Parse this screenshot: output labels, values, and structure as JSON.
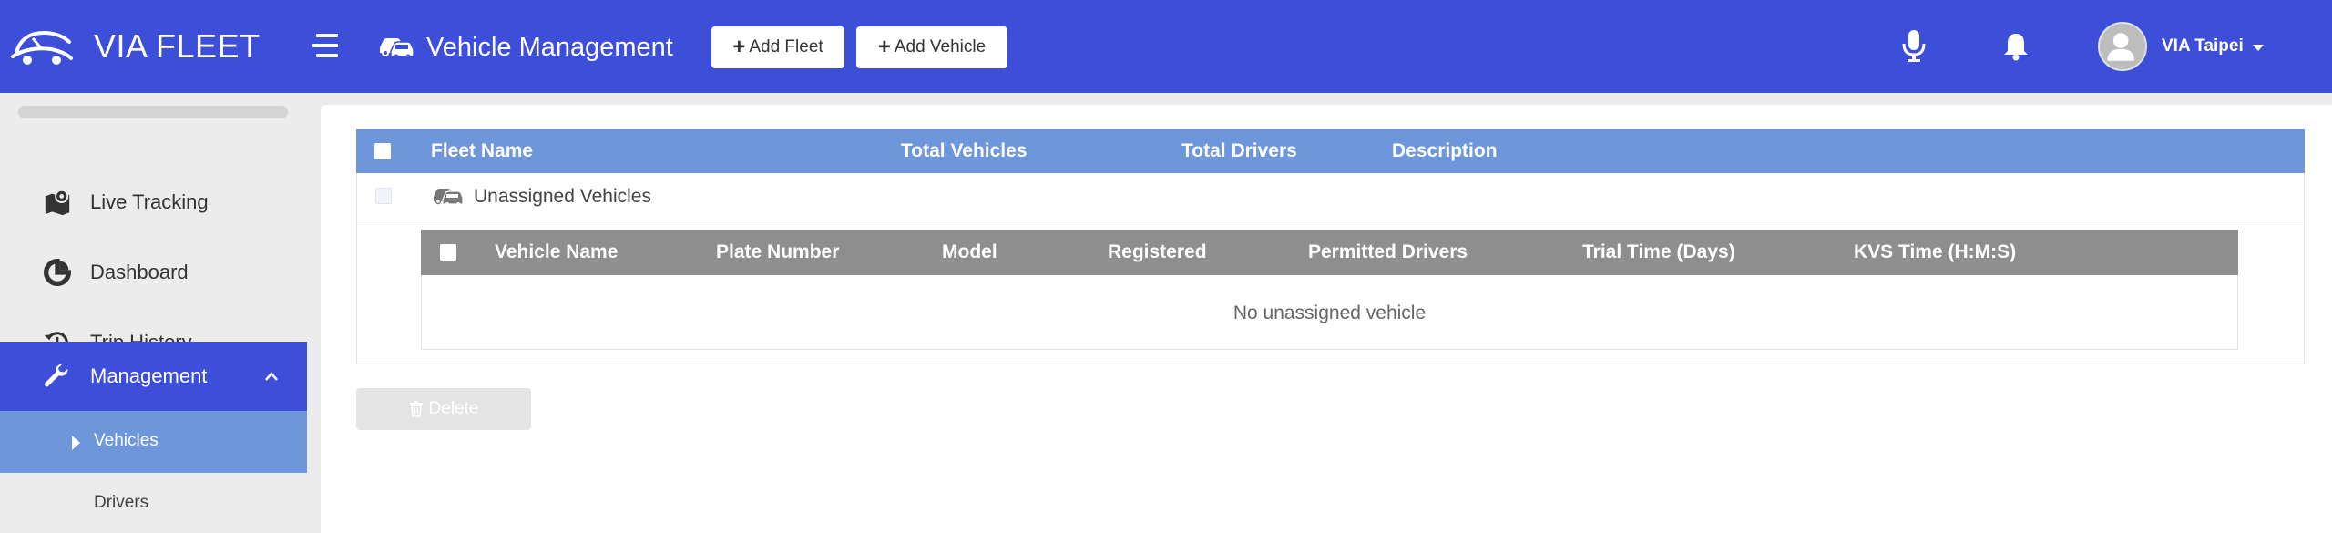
{
  "header": {
    "brand": "VIA FLEET",
    "page_title": "Vehicle Management",
    "add_fleet_label": "Add Fleet",
    "add_vehicle_label": "Add Vehicle",
    "user_name": "VIA Taipei",
    "icons": {
      "logo": "car-logo-icon",
      "menu": "hamburger-menu-icon",
      "page": "vehicles-icon",
      "mic": "microphone-icon",
      "bell": "bell-icon",
      "avatar": "user-avatar-icon"
    },
    "colors": {
      "bar": "#3d4fd9"
    }
  },
  "sidebar": {
    "items": [
      {
        "label": "Live Tracking",
        "icon": "map-pin-icon"
      },
      {
        "label": "Dashboard",
        "icon": "pie-chart-icon"
      },
      {
        "label": "Trip History",
        "icon": "history-icon"
      },
      {
        "label": "Management",
        "icon": "wrench-icon",
        "active": true,
        "expanded": true
      }
    ],
    "sub_items": [
      {
        "label": "Vehicles",
        "active": true
      },
      {
        "label": "Drivers"
      }
    ]
  },
  "fleet_table": {
    "columns": [
      "Fleet Name",
      "Total Vehicles",
      "Total Drivers",
      "Description"
    ],
    "rows": [
      {
        "name": "Unassigned Vehicles",
        "icon": "vehicles-icon"
      }
    ]
  },
  "vehicle_table": {
    "columns": [
      "Vehicle Name",
      "Plate Number",
      "Model",
      "Registered",
      "Permitted Drivers",
      "Trial Time (Days)",
      "KVS Time (H:M:S)"
    ],
    "empty_message": "No unassigned vehicle"
  },
  "actions": {
    "delete_label": "Delete",
    "delete_icon": "trash-icon"
  }
}
